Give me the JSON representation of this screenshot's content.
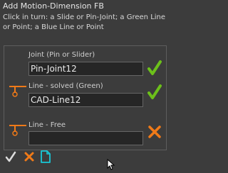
{
  "dialog": {
    "title": "Add Motion-Dimension FB",
    "instructions": "Click in turn: a Slide or Pin-Joint; a Green Line or Point; a Blue Line or Point"
  },
  "rows": [
    {
      "label": "Joint (Pin or Slider)",
      "value": "Pin-Joint12",
      "status": "check-icon"
    },
    {
      "label": "Line - solved (Green)",
      "value": "CAD-Line12",
      "status": "check-icon"
    },
    {
      "label": "Line - Free",
      "value": "",
      "status": "cross-icon"
    }
  ],
  "colors": {
    "check": "#6cc01a",
    "cross": "#f07a18",
    "new": "#18c8d8",
    "background": "#3c3c3c"
  },
  "toolbar": [
    "check-icon",
    "cross-icon",
    "new-document-icon"
  ]
}
